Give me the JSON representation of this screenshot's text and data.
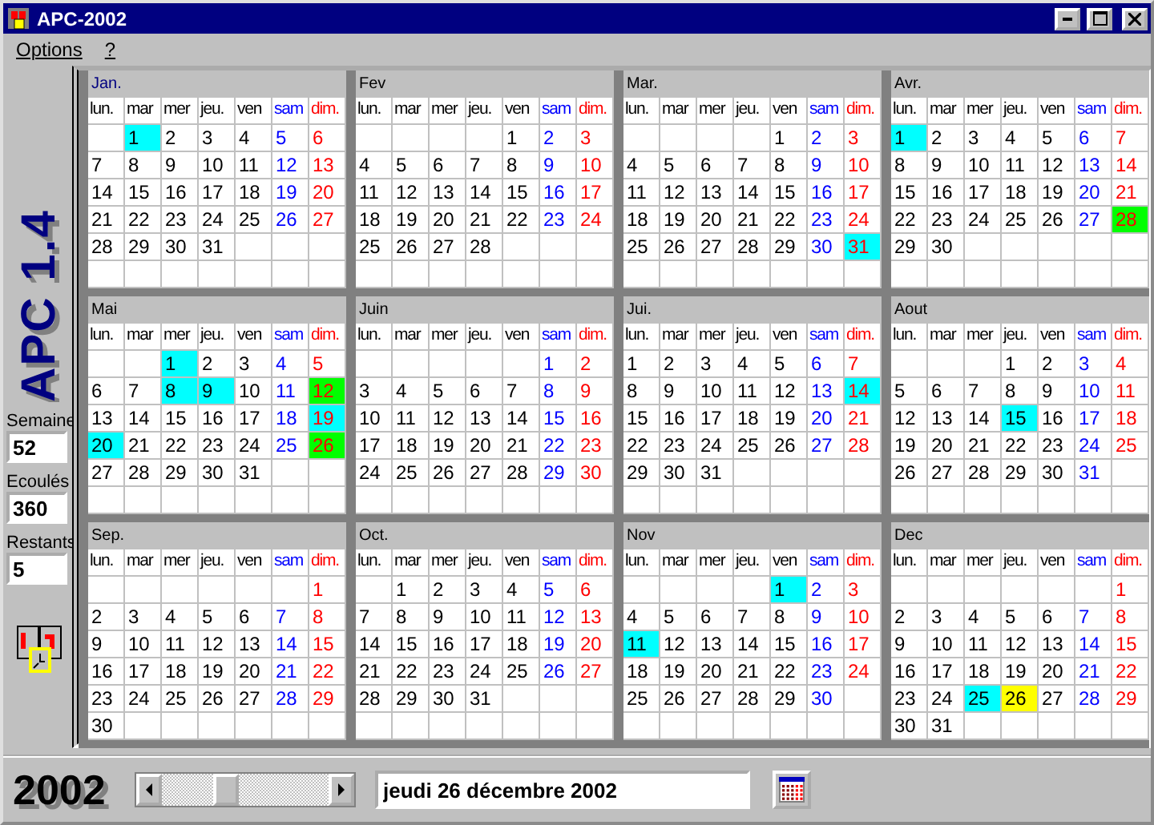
{
  "window": {
    "title": "APC-2002"
  },
  "menu": [
    "Options",
    "?"
  ],
  "sidebar": {
    "logo": "APC 1.4",
    "fields": [
      {
        "label": "Semaine",
        "value": "52"
      },
      {
        "label": "Ecoulés",
        "value": "360"
      },
      {
        "label": "Restants",
        "value": "5"
      }
    ]
  },
  "months": [
    {
      "name": "Jan.",
      "weekdays": [
        "lun.",
        "mar",
        "mer",
        "jeu.",
        "ven",
        "sam",
        "dim."
      ],
      "weeks": [
        [
          {
            "day": "1",
            "color": "#00ffff"
          },
          "2",
          "3",
          "4",
          "5",
          "6"
        ],
        [
          "7",
          "8",
          "9",
          "10",
          "11",
          "12",
          "13"
        ],
        [
          "14",
          "15",
          "16",
          "17",
          "18",
          "19",
          "20"
        ],
        [
          "21",
          "22",
          "23",
          "24",
          "25",
          "26",
          "27"
        ],
        [
          "28",
          "29",
          "30",
          "31"
        ]
      ]
    },
    {
      "name": "Fev",
      "weekdays": [
        "lun.",
        "mar",
        "mer",
        "jeu.",
        "ven",
        "sam",
        "dim."
      ],
      "weeks": [
        [
          "1",
          "2",
          "3"
        ],
        [
          "4",
          "5",
          "6",
          "7",
          "8",
          "9",
          "10"
        ],
        [
          "11",
          "12",
          "13",
          "14",
          "15",
          "16",
          "17"
        ],
        [
          "18",
          "19",
          "20",
          "21",
          "22",
          "23",
          "24"
        ],
        [
          "25",
          "26",
          "27",
          "28"
        ]
      ]
    },
    {
      "name": "Mar.",
      "weekdays": [
        "lun.",
        "mar",
        "mer",
        "jeu.",
        "ven",
        "sam",
        "dim."
      ],
      "weeks": [
        [
          "1",
          "2",
          "3"
        ],
        [
          "4",
          "5",
          "6",
          "7",
          "8",
          "9",
          "10"
        ],
        [
          "11",
          "12",
          "13",
          "14",
          "15",
          "16",
          "17"
        ],
        [
          "18",
          "19",
          "20",
          "21",
          "22",
          "23",
          "24"
        ],
        [
          "25",
          "26",
          "27",
          "28",
          "29",
          "30",
          {
            "day": "31",
            "color": "#00ffff"
          }
        ]
      ]
    },
    {
      "name": "Avr.",
      "weekdays": [
        "lun.",
        "mar",
        "mer",
        "jeu.",
        "ven",
        "sam",
        "dim."
      ],
      "weeks": [
        [
          {
            "day": "1",
            "color": "#00ffff"
          },
          "2",
          "3",
          "4",
          "5",
          "6",
          "7"
        ],
        [
          "8",
          "9",
          "10",
          "11",
          "12",
          "13",
          "14"
        ],
        [
          "15",
          "16",
          "17",
          "18",
          "19",
          "20",
          "21"
        ],
        [
          "22",
          "23",
          "24",
          "25",
          "26",
          "27",
          {
            "day": "28",
            "color": "#00ff00"
          }
        ],
        [
          "29",
          "30"
        ]
      ]
    },
    {
      "name": "Mai",
      "weekdays": [
        "lun.",
        "mar",
        "mer",
        "jeu.",
        "ven",
        "sam",
        "dim."
      ],
      "weeks": [
        [
          {
            "day": "1",
            "color": "#00ffff"
          },
          "2",
          "3",
          "4",
          "5"
        ],
        [
          "6",
          "7",
          {
            "day": "8",
            "color": "#00ffff"
          },
          {
            "day": "9",
            "color": "#00ffff"
          },
          "10",
          "11",
          {
            "day": "12",
            "color": "#00ff00"
          }
        ],
        [
          "13",
          "14",
          "15",
          "16",
          "17",
          "18",
          {
            "day": "19",
            "color": "#00ffff"
          }
        ],
        [
          {
            "day": "20",
            "color": "#00ffff"
          },
          "21",
          "22",
          "23",
          "24",
          "25",
          {
            "day": "26",
            "color": "#00ff00"
          }
        ],
        [
          "27",
          "28",
          "29",
          "30",
          "31"
        ]
      ]
    },
    {
      "name": "Juin",
      "weekdays": [
        "lun.",
        "mar",
        "mer",
        "jeu.",
        "ven",
        "sam",
        "dim."
      ],
      "weeks": [
        [
          "1",
          "2"
        ],
        [
          "3",
          "4",
          "5",
          "6",
          "7",
          "8",
          "9"
        ],
        [
          "10",
          "11",
          "12",
          "13",
          "14",
          "15",
          "16"
        ],
        [
          "17",
          "18",
          "19",
          "20",
          "21",
          "22",
          "23"
        ],
        [
          "24",
          "25",
          "26",
          "27",
          "28",
          "29",
          "30"
        ]
      ]
    },
    {
      "name": "Jui.",
      "weekdays": [
        "lun.",
        "mar",
        "mer",
        "jeu.",
        "ven",
        "sam",
        "dim."
      ],
      "weeks": [
        [
          "1",
          "2",
          "3",
          "4",
          "5",
          "6",
          "7"
        ],
        [
          "8",
          "9",
          "10",
          "11",
          "12",
          "13",
          {
            "day": "14",
            "color": "#00ffff"
          }
        ],
        [
          "15",
          "16",
          "17",
          "18",
          "19",
          "20",
          "21"
        ],
        [
          "22",
          "23",
          "24",
          "25",
          "26",
          "27",
          "28"
        ],
        [
          "29",
          "30",
          "31"
        ]
      ]
    },
    {
      "name": "Aout",
      "weekdays": [
        "lun.",
        "mar",
        "mer",
        "jeu.",
        "ven",
        "sam",
        "dim."
      ],
      "weeks": [
        [
          "1",
          "2",
          "3",
          "4"
        ],
        [
          "5",
          "6",
          "7",
          "8",
          "9",
          "10",
          "11"
        ],
        [
          "12",
          "13",
          "14",
          {
            "day": "15",
            "color": "#00ffff"
          },
          "16",
          "17",
          "18"
        ],
        [
          "19",
          "20",
          "21",
          "22",
          "23",
          "24",
          "25"
        ],
        [
          "26",
          "27",
          "28",
          "29",
          "30",
          "31"
        ]
      ]
    },
    {
      "name": "Sep.",
      "weekdays": [
        "lun.",
        "mar",
        "mer",
        "jeu.",
        "ven",
        "sam",
        "dim."
      ],
      "weeks": [
        [
          "1"
        ],
        [
          "2",
          "3",
          "4",
          "5",
          "6",
          "7",
          "8"
        ],
        [
          "9",
          "10",
          "11",
          "12",
          "13",
          "14",
          "15"
        ],
        [
          "16",
          "17",
          "18",
          "19",
          "20",
          "21",
          "22"
        ],
        [
          "23",
          "24",
          "25",
          "26",
          "27",
          "28",
          "29"
        ],
        [
          "30"
        ]
      ]
    },
    {
      "name": "Oct.",
      "weekdays": [
        "lun.",
        "mar",
        "mer",
        "jeu.",
        "ven",
        "sam",
        "dim."
      ],
      "weeks": [
        [
          "1",
          "2",
          "3",
          "4",
          "5",
          "6"
        ],
        [
          "7",
          "8",
          "9",
          "10",
          "11",
          "12",
          "13"
        ],
        [
          "14",
          "15",
          "16",
          "17",
          "18",
          "19",
          "20"
        ],
        [
          "21",
          "22",
          "23",
          "24",
          "25",
          "26",
          "27"
        ],
        [
          "28",
          "29",
          "30",
          "31"
        ]
      ]
    },
    {
      "name": "Nov",
      "weekdays": [
        "lun.",
        "mar",
        "mer",
        "jeu.",
        "ven",
        "sam",
        "dim."
      ],
      "weeks": [
        [
          {
            "day": "1",
            "color": "#00ffff"
          },
          "2",
          "3"
        ],
        [
          "4",
          "5",
          "6",
          "7",
          "8",
          "9",
          "10"
        ],
        [
          {
            "day": "11",
            "color": "#00ffff"
          },
          "12",
          "13",
          "14",
          "15",
          "16",
          "17"
        ],
        [
          "18",
          "19",
          "20",
          "21",
          "22",
          "23",
          "24"
        ],
        [
          "25",
          "26",
          "27",
          "28",
          "29",
          "30"
        ]
      ]
    },
    {
      "name": "Dec",
      "weekdays": [
        "lun.",
        "mar",
        "mer",
        "jeu.",
        "ven",
        "sam",
        "dim."
      ],
      "weeks": [
        [
          "1"
        ],
        [
          "2",
          "3",
          "4",
          "5",
          "6",
          "7",
          "8"
        ],
        [
          "9",
          "10",
          "11",
          "12",
          "13",
          "14",
          "15"
        ],
        [
          "16",
          "17",
          "18",
          "19",
          "20",
          "21",
          "22"
        ],
        [
          "23",
          "24",
          {
            "day": "25",
            "color": "#00ffff"
          },
          {
            "day": "26",
            "color": "#ffff00"
          },
          "27",
          "28",
          "29"
        ],
        [
          "30",
          "31"
        ]
      ]
    }
  ],
  "footer": {
    "year": "2002",
    "date": "jeudi 26 décembre 2002"
  }
}
